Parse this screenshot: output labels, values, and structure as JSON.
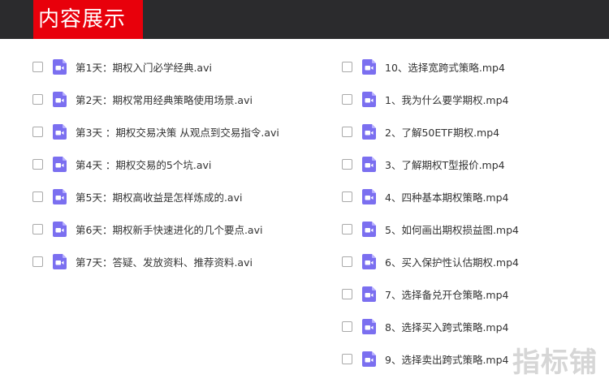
{
  "header": {
    "title": "内容展示"
  },
  "left_files": [
    "第1天：期权入门必学经典.avi",
    "第2天：期权常用经典策略使用场景.avi",
    "第3天 ：期权交易决策 从观点到交易指令.avi",
    "第4天 ：期权交易的5个坑.avi",
    "第5天：期权高收益是怎样炼成的.avi",
    "第6天：期权新手快速进化的几个要点.avi",
    "第7天：答疑、发放资料、推荐资料.avi"
  ],
  "right_files": [
    "10、选择宽跨式策略.mp4",
    "1、我为什么要学期权.mp4",
    "2、了解50ETF期权.mp4",
    "3、了解期权T型报价.mp4",
    "4、四种基本期权策略.mp4",
    "5、如何画出期权损益图.mp4",
    "6、买入保护性认估期权.mp4",
    "7、选择备兑开仓策略.mp4",
    "8、选择买入跨式策略.mp4",
    "9、选择卖出跨式策略.mp4"
  ],
  "icon": {
    "name": "video-file-icon",
    "color": "#7b6ff0"
  },
  "watermark": "指标铺"
}
